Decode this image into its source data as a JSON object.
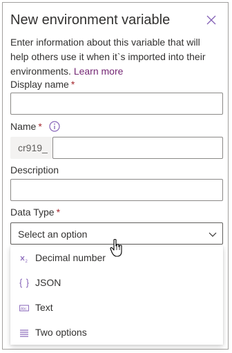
{
  "panel": {
    "title": "New environment variable",
    "description": "Enter information about this variable that will help others use it when it`s imported into their environments.",
    "learn_more": "Learn more"
  },
  "fields": {
    "display_name": {
      "label": "Display name",
      "required": "*",
      "value": ""
    },
    "name": {
      "label": "Name",
      "required": "*",
      "prefix": "cr919_"
    },
    "description": {
      "label": "Description",
      "value": ""
    },
    "data_type": {
      "label": "Data Type",
      "required": "*",
      "placeholder": "Select an option"
    }
  },
  "dropdown": {
    "options": [
      {
        "label": "Decimal number",
        "icon": "decimal-icon"
      },
      {
        "label": "JSON",
        "icon": "json-braces-icon"
      },
      {
        "label": "Text",
        "icon": "text-field-icon"
      },
      {
        "label": "Two options",
        "icon": "list-icon"
      }
    ]
  },
  "colors": {
    "link": "#742774",
    "required": "#a4262c",
    "icon_purple": "#8764b8"
  }
}
